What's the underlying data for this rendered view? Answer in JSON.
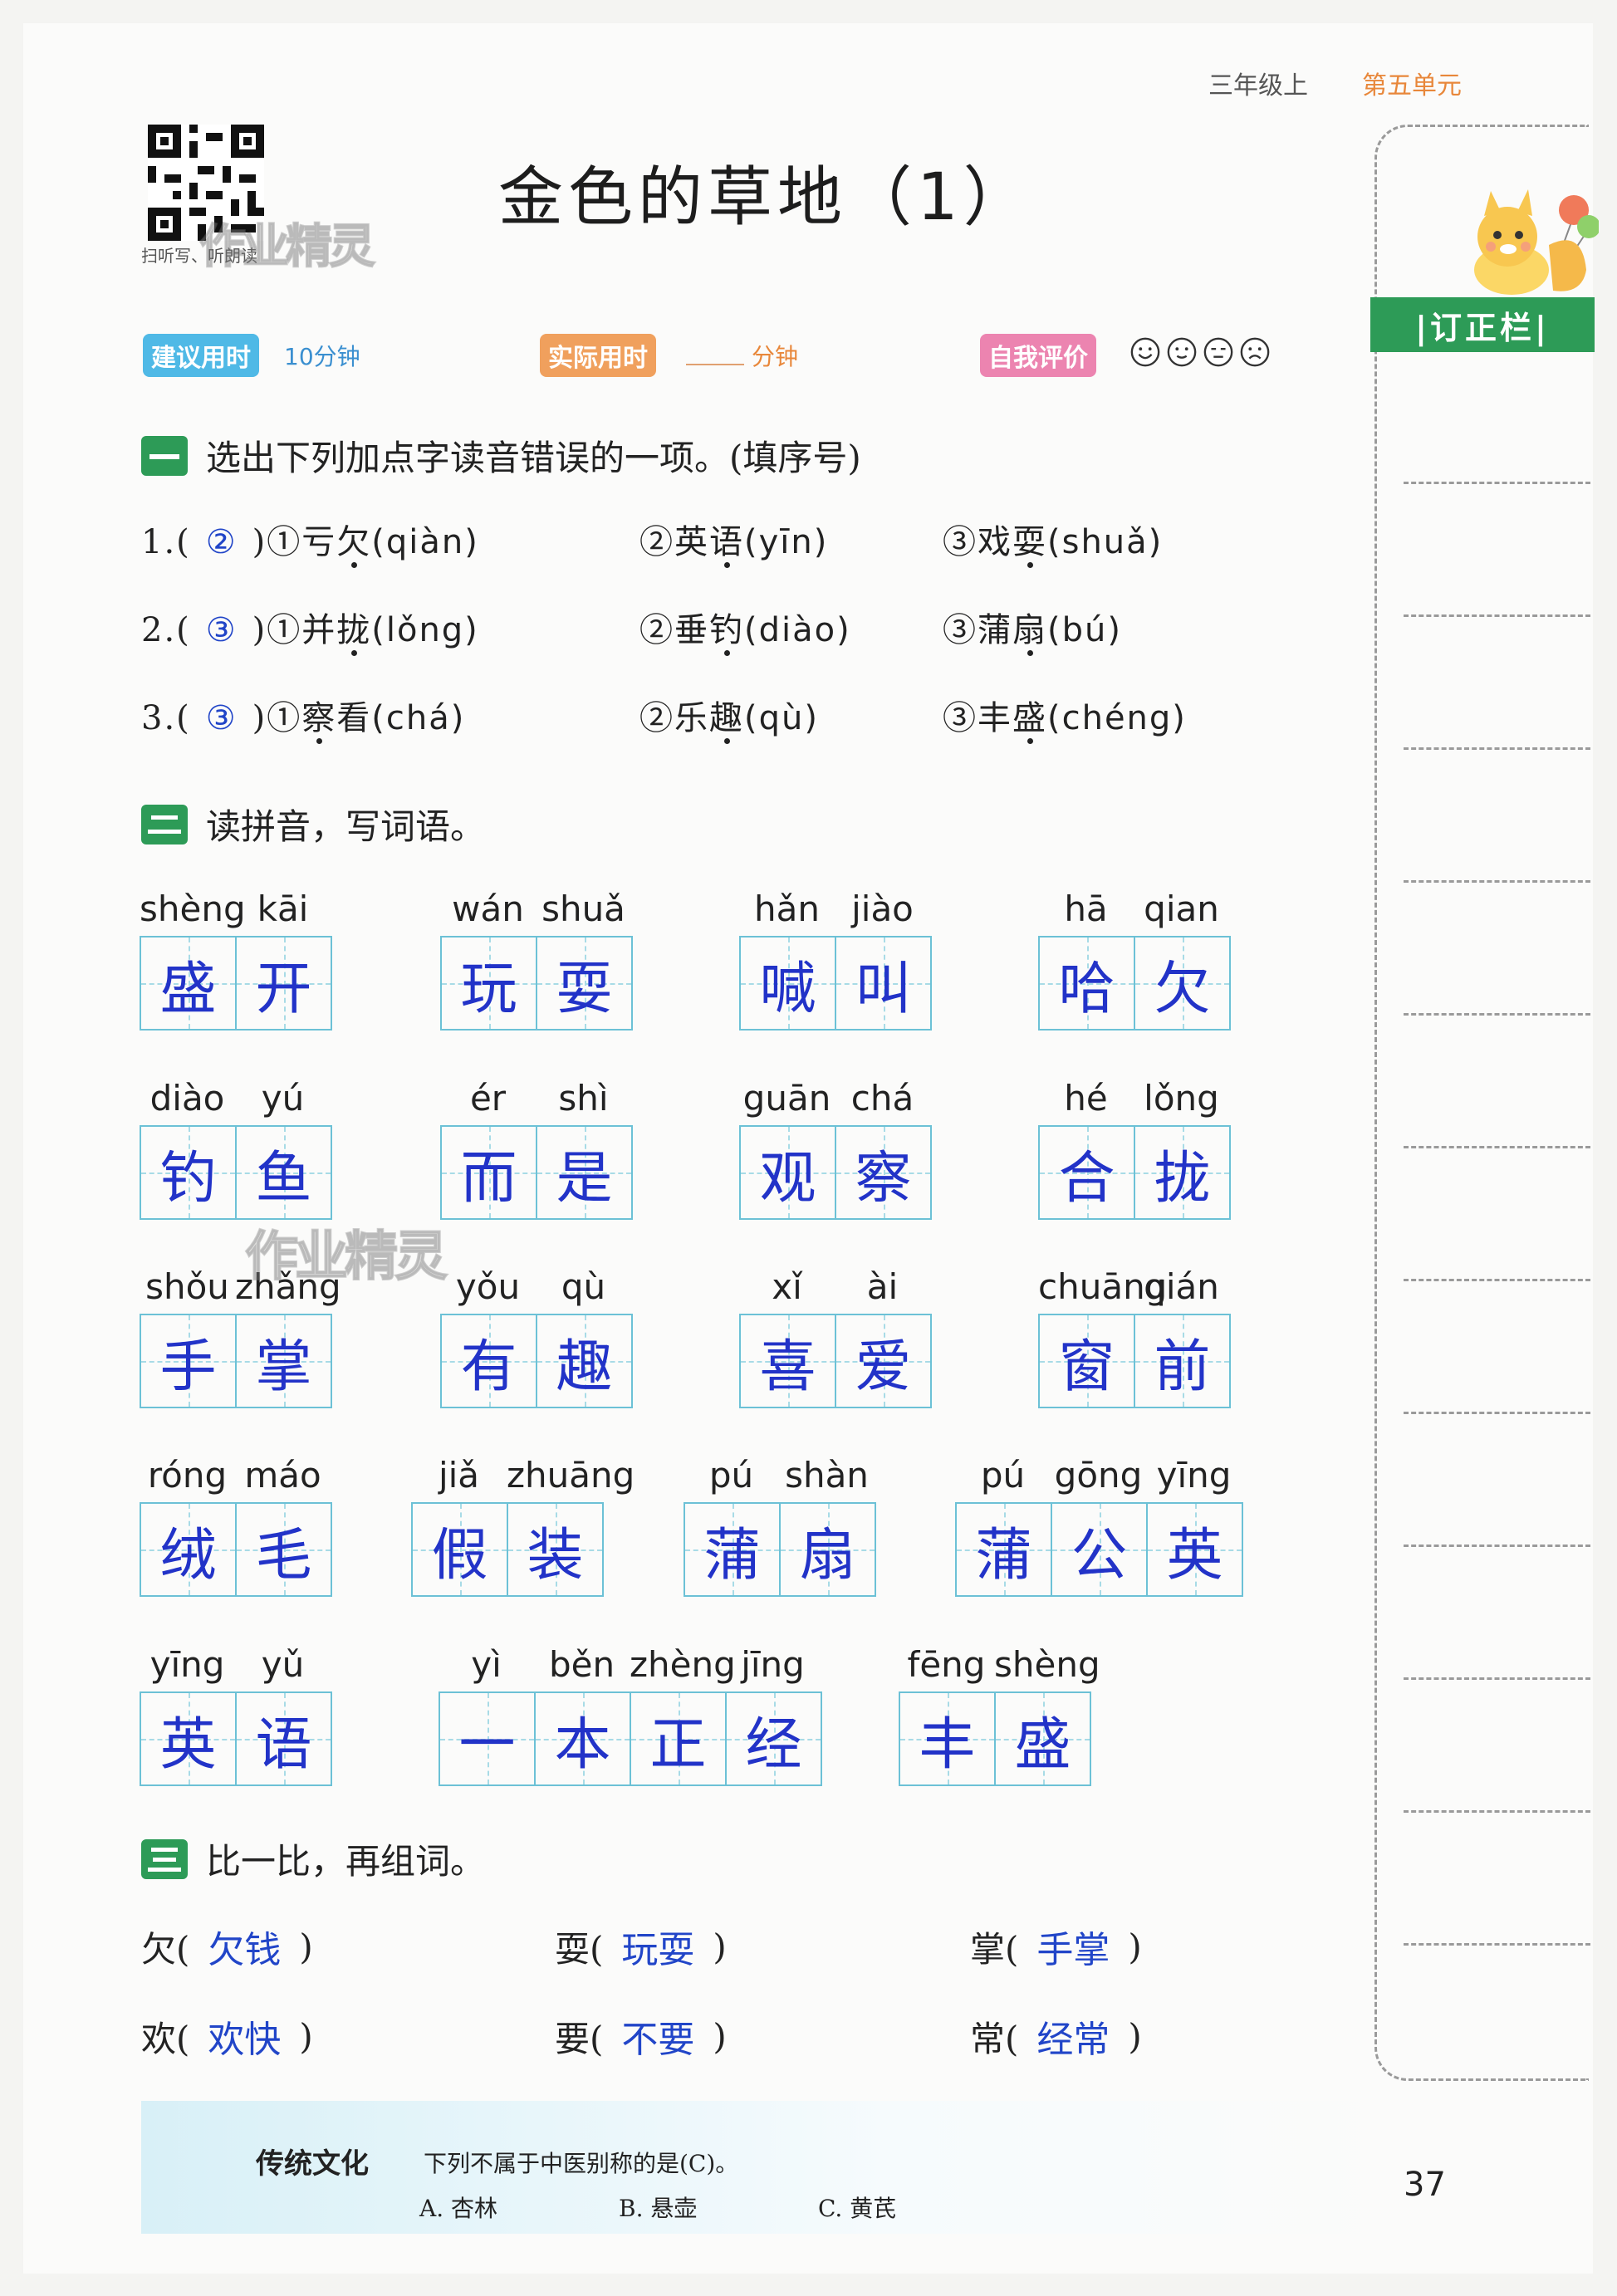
{
  "header": {
    "grade": "三年级上",
    "unit": "第五单元",
    "qr_label": "扫听写、听朗读",
    "title": "金色的草地（1）",
    "watermark": "作业精灵"
  },
  "timers": {
    "suggested_label": "建议用时",
    "suggested_value": "10分钟",
    "actual_label": "实际用时",
    "actual_unit": "分钟",
    "self_eval_label": "自我评价"
  },
  "correction_label": "|订正栏|",
  "section1": {
    "number": "一",
    "instruction": "选出下列加点字读音错误的一项。(填序号)",
    "rows": [
      {
        "num": "1.(",
        "answer": "②",
        "close": ")",
        "o1": "①亏",
        "o1dot": "欠",
        "o1py": "(qiàn)",
        "o2": "②英",
        "o2dot": "语",
        "o2py": "(yīn)",
        "o3": "③戏",
        "o3dot": "耍",
        "o3py": "(shuǎ)"
      },
      {
        "num": "2.(",
        "answer": "③",
        "close": ")",
        "o1": "①并",
        "o1dot": "拢",
        "o1py": "(lǒng)",
        "o2": "②垂",
        "o2dot": "钓",
        "o2py": "(diào)",
        "o3": "③蒲",
        "o3dot": "扇",
        "o3py": "(bú)"
      },
      {
        "num": "3.(",
        "answer": "③",
        "close": ")",
        "o1": "①",
        "o1dot": "察",
        "o1post": "看",
        "o1py": "(chá)",
        "o2": "②乐",
        "o2dot": "趣",
        "o2py": "(qù)",
        "o3": "③丰",
        "o3dot": "盛",
        "o3py": "(chéng)"
      }
    ]
  },
  "section2": {
    "number": "二",
    "instruction": "读拼音，写词语。",
    "words": [
      {
        "py": [
          "shèng",
          "kāi"
        ],
        "chars": [
          "盛",
          "开"
        ]
      },
      {
        "py": [
          "wán",
          "shuǎ"
        ],
        "chars": [
          "玩",
          "耍"
        ]
      },
      {
        "py": [
          "hǎn",
          "jiào"
        ],
        "chars": [
          "喊",
          "叫"
        ]
      },
      {
        "py": [
          "hā",
          "qian"
        ],
        "chars": [
          "哈",
          "欠"
        ]
      },
      {
        "py": [
          "diào",
          "yú"
        ],
        "chars": [
          "钓",
          "鱼"
        ]
      },
      {
        "py": [
          "ér",
          "shì"
        ],
        "chars": [
          "而",
          "是"
        ]
      },
      {
        "py": [
          "guān",
          "chá"
        ],
        "chars": [
          "观",
          "察"
        ]
      },
      {
        "py": [
          "hé",
          "lǒng"
        ],
        "chars": [
          "合",
          "拢"
        ]
      },
      {
        "py": [
          "shǒu",
          "zhǎng"
        ],
        "chars": [
          "手",
          "掌"
        ]
      },
      {
        "py": [
          "yǒu",
          "qù"
        ],
        "chars": [
          "有",
          "趣"
        ]
      },
      {
        "py": [
          "xǐ",
          "ài"
        ],
        "chars": [
          "喜",
          "爱"
        ]
      },
      {
        "py": [
          "chuāng",
          "qián"
        ],
        "chars": [
          "窗",
          "前"
        ]
      },
      {
        "py": [
          "róng",
          "máo"
        ],
        "chars": [
          "绒",
          "毛"
        ]
      },
      {
        "py": [
          "jiǎ",
          "zhuāng"
        ],
        "chars": [
          "假",
          "装"
        ]
      },
      {
        "py": [
          "pú",
          "shàn"
        ],
        "chars": [
          "蒲",
          "扇"
        ]
      },
      {
        "py": [
          "pú",
          "gōng",
          "yīng"
        ],
        "chars": [
          "蒲",
          "公",
          "英"
        ]
      },
      {
        "py": [
          "yīng",
          "yǔ"
        ],
        "chars": [
          "英",
          "语"
        ]
      },
      {
        "py": [
          "yì",
          "běn",
          "zhèng",
          "jīng"
        ],
        "chars": [
          "一",
          "本",
          "正",
          "经"
        ]
      },
      {
        "py": [
          "fēng",
          "shèng"
        ],
        "chars": [
          "丰",
          "盛"
        ]
      }
    ]
  },
  "section3": {
    "number": "三",
    "instruction": "比一比，再组词。",
    "items": [
      {
        "char": "欠(",
        "answer": "欠钱",
        "close": ")"
      },
      {
        "char": "耍(",
        "answer": "玩耍",
        "close": ")"
      },
      {
        "char": "掌(",
        "answer": "手掌",
        "close": ")"
      },
      {
        "char": "欢(",
        "answer": "欢快",
        "close": ")"
      },
      {
        "char": "要(",
        "answer": "不要",
        "close": ")"
      },
      {
        "char": "常(",
        "answer": "经常",
        "close": ")"
      }
    ]
  },
  "culture": {
    "title": "传统文化",
    "question": "下列不属于中医别称的是(C)。",
    "options": [
      "A. 杏林",
      "B. 悬壶",
      "C. 黄芪"
    ]
  },
  "page_number": "37"
}
